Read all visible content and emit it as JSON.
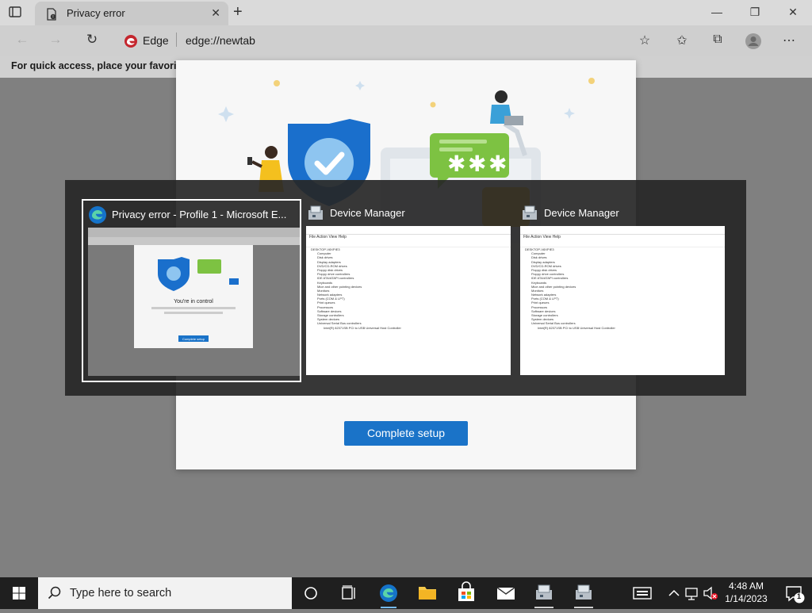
{
  "browser": {
    "tab_title": "Privacy error",
    "edge_label": "Edge",
    "url": "edge://newtab",
    "favorites_hint": "For quick access, place your favorites h"
  },
  "modal": {
    "button_label": "Complete setup"
  },
  "switcher": {
    "windows": [
      {
        "title": "Privacy error - Profile 1 - Microsoft E...",
        "selected": true
      },
      {
        "title": "Device Manager"
      },
      {
        "title": "Device Manager"
      }
    ],
    "edge_preview": {
      "heading": "You're in control",
      "button": "Complete setup"
    },
    "device_manager_tree": [
      "DESKTOP-V8XPIE3",
      "Computer",
      "Disk drives",
      "Display adapters",
      "DVD/CD-ROM drives",
      "Floppy disk drives",
      "Floppy drive controllers",
      "IDE ATA/ATAPI controllers",
      "Keyboards",
      "Mice and other pointing devices",
      "Monitors",
      "Network adapters",
      "Ports (COM & LPT)",
      "Print queues",
      "Processors",
      "Software devices",
      "Storage controllers",
      "System devices",
      "Universal Serial Bus controllers",
      "Intel(R) 82371SB PCI to USB Universal Host Controller"
    ],
    "dm_menu": "File  Action  View  Help"
  },
  "taskbar": {
    "search_placeholder": "Type here to search",
    "time": "4:48 AM",
    "date": "1/14/2023",
    "notification_count": "1"
  },
  "colors": {
    "accent": "#1a73c8",
    "edge_logo_red": "#c4262e",
    "shield_blue": "#1a6fcc",
    "chat_green": "#7dc242"
  }
}
